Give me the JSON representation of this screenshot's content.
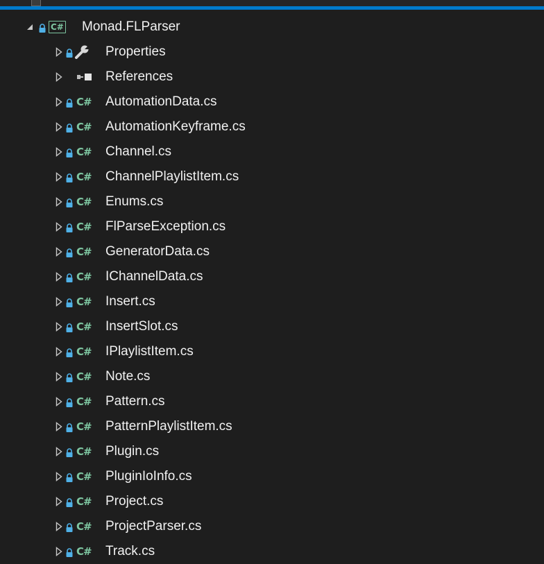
{
  "colors": {
    "background": "#1e1e1e",
    "accent": "#007acc",
    "text": "#f1f1f1",
    "lock": "#4fb0e6",
    "csharp": "#7ec6a1",
    "expander": "#c8c8c8"
  },
  "project": {
    "name": "Monad.FLParser",
    "type_icon_text": "C#",
    "expanded": true
  },
  "items": [
    {
      "label": "Properties",
      "icon": "wrench-icon",
      "lock": true
    },
    {
      "label": "References",
      "icon": "references-icon",
      "lock": false
    },
    {
      "label": "AutomationData.cs",
      "icon": "csharp-file-icon",
      "icon_text": "C#",
      "lock": true
    },
    {
      "label": "AutomationKeyframe.cs",
      "icon": "csharp-file-icon",
      "icon_text": "C#",
      "lock": true
    },
    {
      "label": "Channel.cs",
      "icon": "csharp-file-icon",
      "icon_text": "C#",
      "lock": true
    },
    {
      "label": "ChannelPlaylistItem.cs",
      "icon": "csharp-file-icon",
      "icon_text": "C#",
      "lock": true
    },
    {
      "label": "Enums.cs",
      "icon": "csharp-file-icon",
      "icon_text": "C#",
      "lock": true
    },
    {
      "label": "FlParseException.cs",
      "icon": "csharp-file-icon",
      "icon_text": "C#",
      "lock": true
    },
    {
      "label": "GeneratorData.cs",
      "icon": "csharp-file-icon",
      "icon_text": "C#",
      "lock": true
    },
    {
      "label": "IChannelData.cs",
      "icon": "csharp-file-icon",
      "icon_text": "C#",
      "lock": true
    },
    {
      "label": "Insert.cs",
      "icon": "csharp-file-icon",
      "icon_text": "C#",
      "lock": true
    },
    {
      "label": "InsertSlot.cs",
      "icon": "csharp-file-icon",
      "icon_text": "C#",
      "lock": true
    },
    {
      "label": "IPlaylistItem.cs",
      "icon": "csharp-file-icon",
      "icon_text": "C#",
      "lock": true
    },
    {
      "label": "Note.cs",
      "icon": "csharp-file-icon",
      "icon_text": "C#",
      "lock": true
    },
    {
      "label": "Pattern.cs",
      "icon": "csharp-file-icon",
      "icon_text": "C#",
      "lock": true
    },
    {
      "label": "PatternPlaylistItem.cs",
      "icon": "csharp-file-icon",
      "icon_text": "C#",
      "lock": true
    },
    {
      "label": "Plugin.cs",
      "icon": "csharp-file-icon",
      "icon_text": "C#",
      "lock": true
    },
    {
      "label": "PluginIoInfo.cs",
      "icon": "csharp-file-icon",
      "icon_text": "C#",
      "lock": true
    },
    {
      "label": "Project.cs",
      "icon": "csharp-file-icon",
      "icon_text": "C#",
      "lock": true
    },
    {
      "label": "ProjectParser.cs",
      "icon": "csharp-file-icon",
      "icon_text": "C#",
      "lock": true
    },
    {
      "label": "Track.cs",
      "icon": "csharp-file-icon",
      "icon_text": "C#",
      "lock": true
    }
  ]
}
